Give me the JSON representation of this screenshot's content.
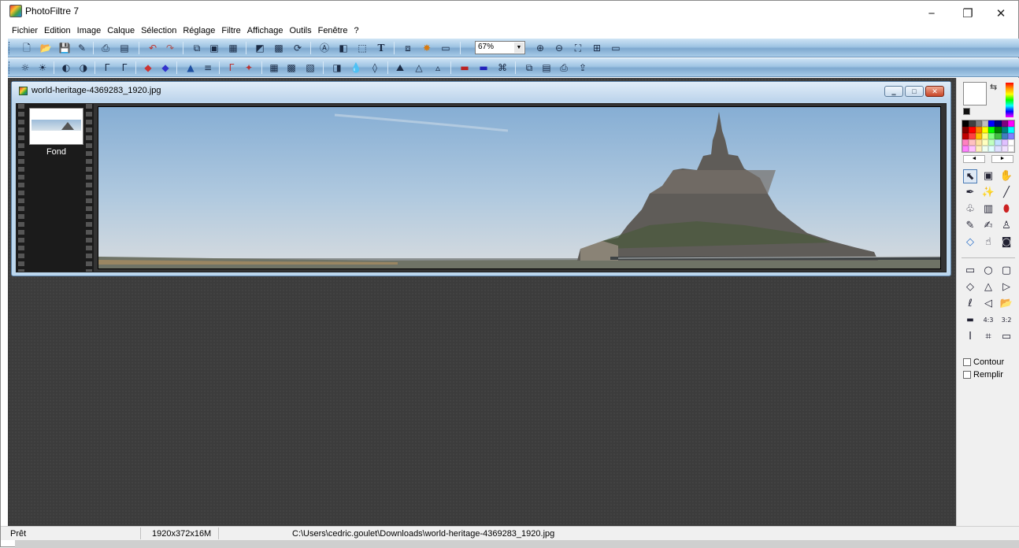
{
  "app": {
    "title": "PhotoFiltre 7",
    "window_controls": {
      "minimize": "−",
      "restore": "❐",
      "close": "✕"
    }
  },
  "menu": [
    "Fichier",
    "Edition",
    "Image",
    "Calque",
    "Sélection",
    "Réglage",
    "Filtre",
    "Affichage",
    "Outils",
    "Fenêtre",
    "?"
  ],
  "toolbar": {
    "zoom_value": "67%",
    "row1_icons": [
      "new-icon",
      "open-icon",
      "save-icon",
      "save-as-icon",
      "print-icon",
      "scan-icon",
      "undo-icon",
      "redo-icon",
      "copy-icon",
      "paste-icon",
      "paste-new-icon",
      "image-size-icon",
      "color-palette-icon",
      "rotate-icon",
      "text-mask-icon",
      "gradient-icon",
      "selection-icon",
      "text-icon",
      "transform-icon",
      "effects-icon",
      "plugin-icon",
      "zoom-in-icon",
      "zoom-out-icon",
      "fit-window-icon",
      "actual-size-icon",
      "fullscreen-icon"
    ],
    "row2_icons": [
      "brightness-down-icon",
      "brightness-up-icon",
      "contrast-down-icon",
      "contrast-up-icon",
      "gamma-down-icon",
      "gamma-up-icon",
      "saturation-down-icon",
      "saturation-up-icon",
      "auto-level-icon",
      "auto-contrast-icon",
      "auto-gamma-icon",
      "auto-color-icon",
      "dust-icon",
      "negative-icon",
      "grayscale-icon",
      "sharpen-icon",
      "blur-icon",
      "soften-icon",
      "emboss-icon",
      "warm-icon",
      "cool-icon",
      "flip-h-icon",
      "flip-v-icon",
      "rotate-left-icon",
      "rotate-right-icon",
      "image-copy-icon",
      "printer-icon",
      "export-icon"
    ]
  },
  "document": {
    "title": "world-heritage-4369283_1920.jpg",
    "layer_name": "Fond",
    "buttons": {
      "minimize": "‗",
      "maximize": "□",
      "close": "✕"
    }
  },
  "tools": {
    "contour_label": "Contour",
    "remplir_label": "Remplir",
    "palette_colors": [
      "#000000",
      "#404040",
      "#7f7f7f",
      "#c0c0c0",
      "#0000ff",
      "#000080",
      "#800080",
      "#ff00ff",
      "#800000",
      "#ff0000",
      "#ff8000",
      "#ffff00",
      "#00ff00",
      "#008000",
      "#008080",
      "#00ffff",
      "#c00000",
      "#ff4040",
      "#ffc000",
      "#ffff80",
      "#80ff80",
      "#40c040",
      "#4080c0",
      "#8080ff",
      "#ff80c0",
      "#ffc0c0",
      "#ffe0a0",
      "#ffffc0",
      "#c0ffc0",
      "#c0e0ff",
      "#e0c0ff",
      "#ffffff",
      "#ff80ff",
      "#ffc0ff",
      "#fff0c0",
      "#f0fff0",
      "#e0ffff",
      "#e0e0ff",
      "#f0e0ff",
      "#ffffff"
    ]
  },
  "status": {
    "state": "Prêt",
    "dimensions": "1920x372x16M",
    "path": "C:\\Users\\cedric.goulet\\Downloads\\world-heritage-4369283_1920.jpg"
  }
}
